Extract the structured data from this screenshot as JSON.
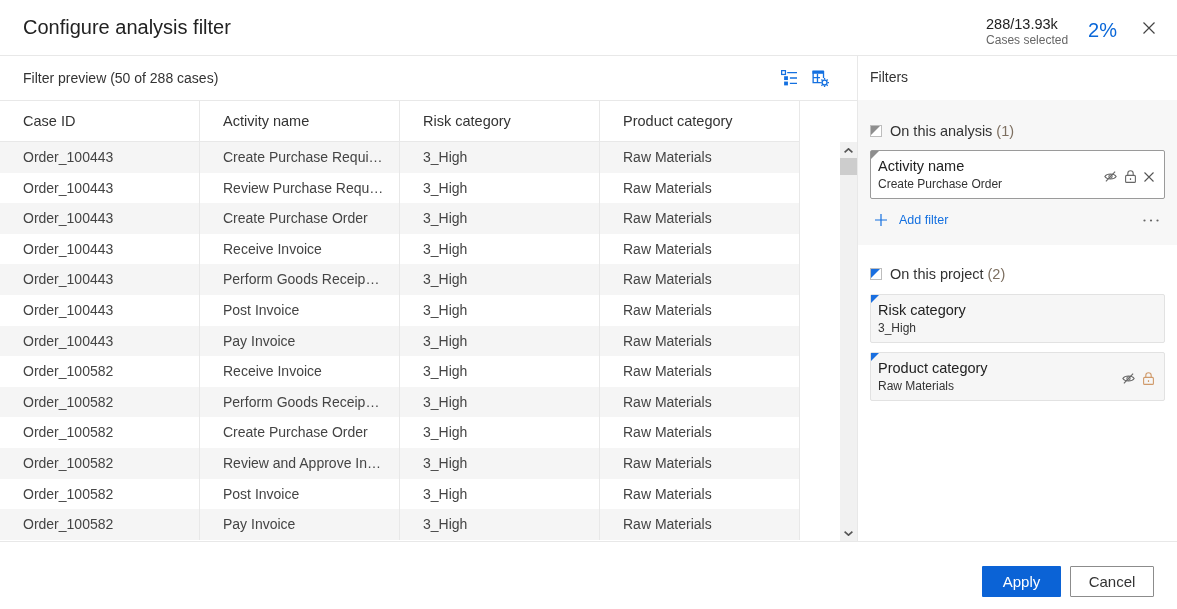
{
  "dialog": {
    "title": "Configure analysis filter",
    "selection": {
      "count": "288/13.93k",
      "label": "Cases selected",
      "percent": "2%"
    }
  },
  "preview": {
    "title": "Filter preview (50 of 288 cases)",
    "columns": [
      "Case ID",
      "Activity name",
      "Risk category",
      "Product category"
    ],
    "rows": [
      [
        "Order_100443",
        "Create Purchase Requi…",
        "3_High",
        "Raw Materials"
      ],
      [
        "Order_100443",
        "Review Purchase Requ…",
        "3_High",
        "Raw Materials"
      ],
      [
        "Order_100443",
        "Create Purchase Order",
        "3_High",
        "Raw Materials"
      ],
      [
        "Order_100443",
        "Receive Invoice",
        "3_High",
        "Raw Materials"
      ],
      [
        "Order_100443",
        "Perform Goods Receip…",
        "3_High",
        "Raw Materials"
      ],
      [
        "Order_100443",
        "Post Invoice",
        "3_High",
        "Raw Materials"
      ],
      [
        "Order_100443",
        "Pay Invoice",
        "3_High",
        "Raw Materials"
      ],
      [
        "Order_100582",
        "Receive Invoice",
        "3_High",
        "Raw Materials"
      ],
      [
        "Order_100582",
        "Perform Goods Receip…",
        "3_High",
        "Raw Materials"
      ],
      [
        "Order_100582",
        "Create Purchase Order",
        "3_High",
        "Raw Materials"
      ],
      [
        "Order_100582",
        "Review and Approve In…",
        "3_High",
        "Raw Materials"
      ],
      [
        "Order_100582",
        "Post Invoice",
        "3_High",
        "Raw Materials"
      ],
      [
        "Order_100582",
        "Pay Invoice",
        "3_High",
        "Raw Materials"
      ]
    ]
  },
  "filters": {
    "title": "Filters",
    "groups": [
      {
        "kind": "analysis",
        "label": "On this analysis",
        "count": "(1)",
        "items": [
          {
            "name": "Activity name",
            "value": "Create Purchase Order",
            "selected": true,
            "controls": [
              {
                "kind": "hide"
              },
              {
                "kind": "lock",
                "on": false
              },
              {
                "kind": "remove"
              }
            ]
          }
        ],
        "add_label": "Add filter"
      },
      {
        "kind": "project",
        "label": "On this project",
        "count": "(2)",
        "items": [
          {
            "name": "Risk category",
            "value": "3_High",
            "selected": false
          },
          {
            "name": "Product category",
            "value": "Raw Materials",
            "selected": false,
            "controls": [
              {
                "kind": "hide"
              },
              {
                "kind": "lock",
                "on": true
              }
            ]
          }
        ]
      }
    ]
  },
  "buttons": [
    {
      "label": "Apply",
      "kind": "primary"
    },
    {
      "label": "Cancel",
      "kind": "secondary"
    }
  ]
}
